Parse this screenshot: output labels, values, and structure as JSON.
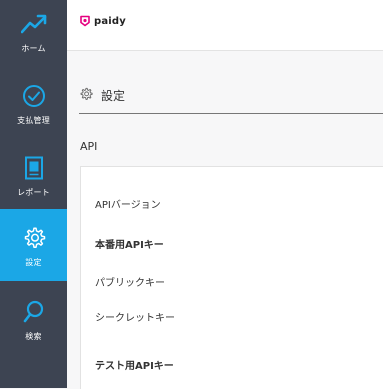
{
  "sidebar": {
    "items": [
      {
        "label": "ホーム",
        "icon": "trend-up-icon"
      },
      {
        "label": "支払管理",
        "icon": "check-circle-icon"
      },
      {
        "label": "レポート",
        "icon": "document-icon"
      },
      {
        "label": "設定",
        "icon": "gear-icon"
      },
      {
        "label": "検索",
        "icon": "search-icon"
      }
    ],
    "active_index": 3
  },
  "header": {
    "logo_text": "paidy"
  },
  "page": {
    "title": "設定",
    "section": "API",
    "rows": [
      {
        "label": "APIバージョン",
        "bold": false
      },
      {
        "label": "本番用APIキー",
        "bold": true
      },
      {
        "label": "パブリックキー",
        "bold": false
      },
      {
        "label": "シークレットキー",
        "bold": false
      },
      {
        "label": "テスト用APIキー",
        "bold": true
      }
    ]
  },
  "colors": {
    "sidebar_bg": "#3d4452",
    "active_bg": "#1ba7e6",
    "icon_color": "#1ba7e6",
    "brand_pink": "#e5007f"
  }
}
